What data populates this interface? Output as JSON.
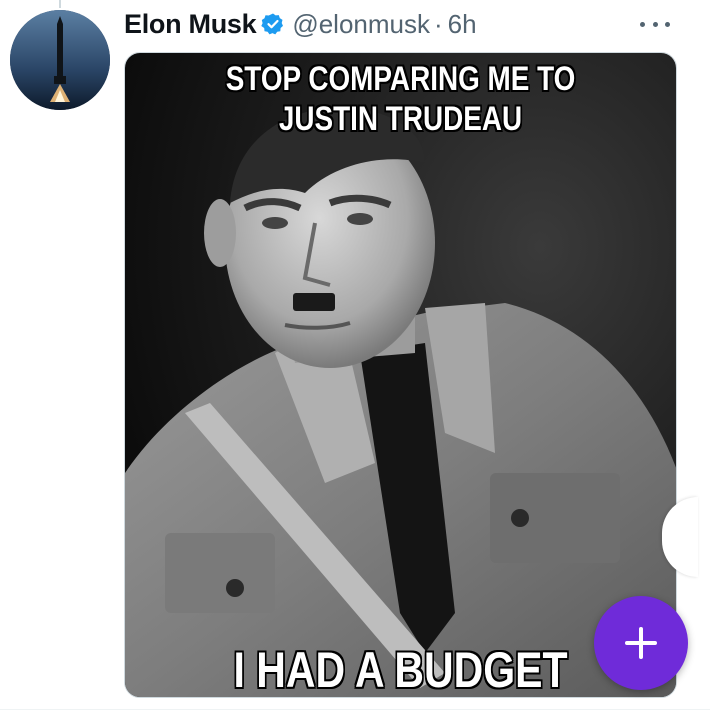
{
  "tweet": {
    "display_name": "Elon Musk",
    "handle": "@elonmusk",
    "separator": "·",
    "timestamp": "6h",
    "verified": true,
    "icons": {
      "avatar": "rocket-launch-avatar",
      "verified": "verified-badge-icon",
      "more": "more-options-icon",
      "compose": "plus-icon"
    },
    "media": {
      "type": "image",
      "style": "black-and-white meme photo",
      "top_text": "STOP COMPARING ME TO JUSTIN TRUDEAU",
      "bottom_text": "I HAD A BUDGET"
    }
  },
  "colors": {
    "verified_blue": "#1d9bf0",
    "secondary_text": "#536471",
    "fab_purple": "#6f2bd9"
  }
}
